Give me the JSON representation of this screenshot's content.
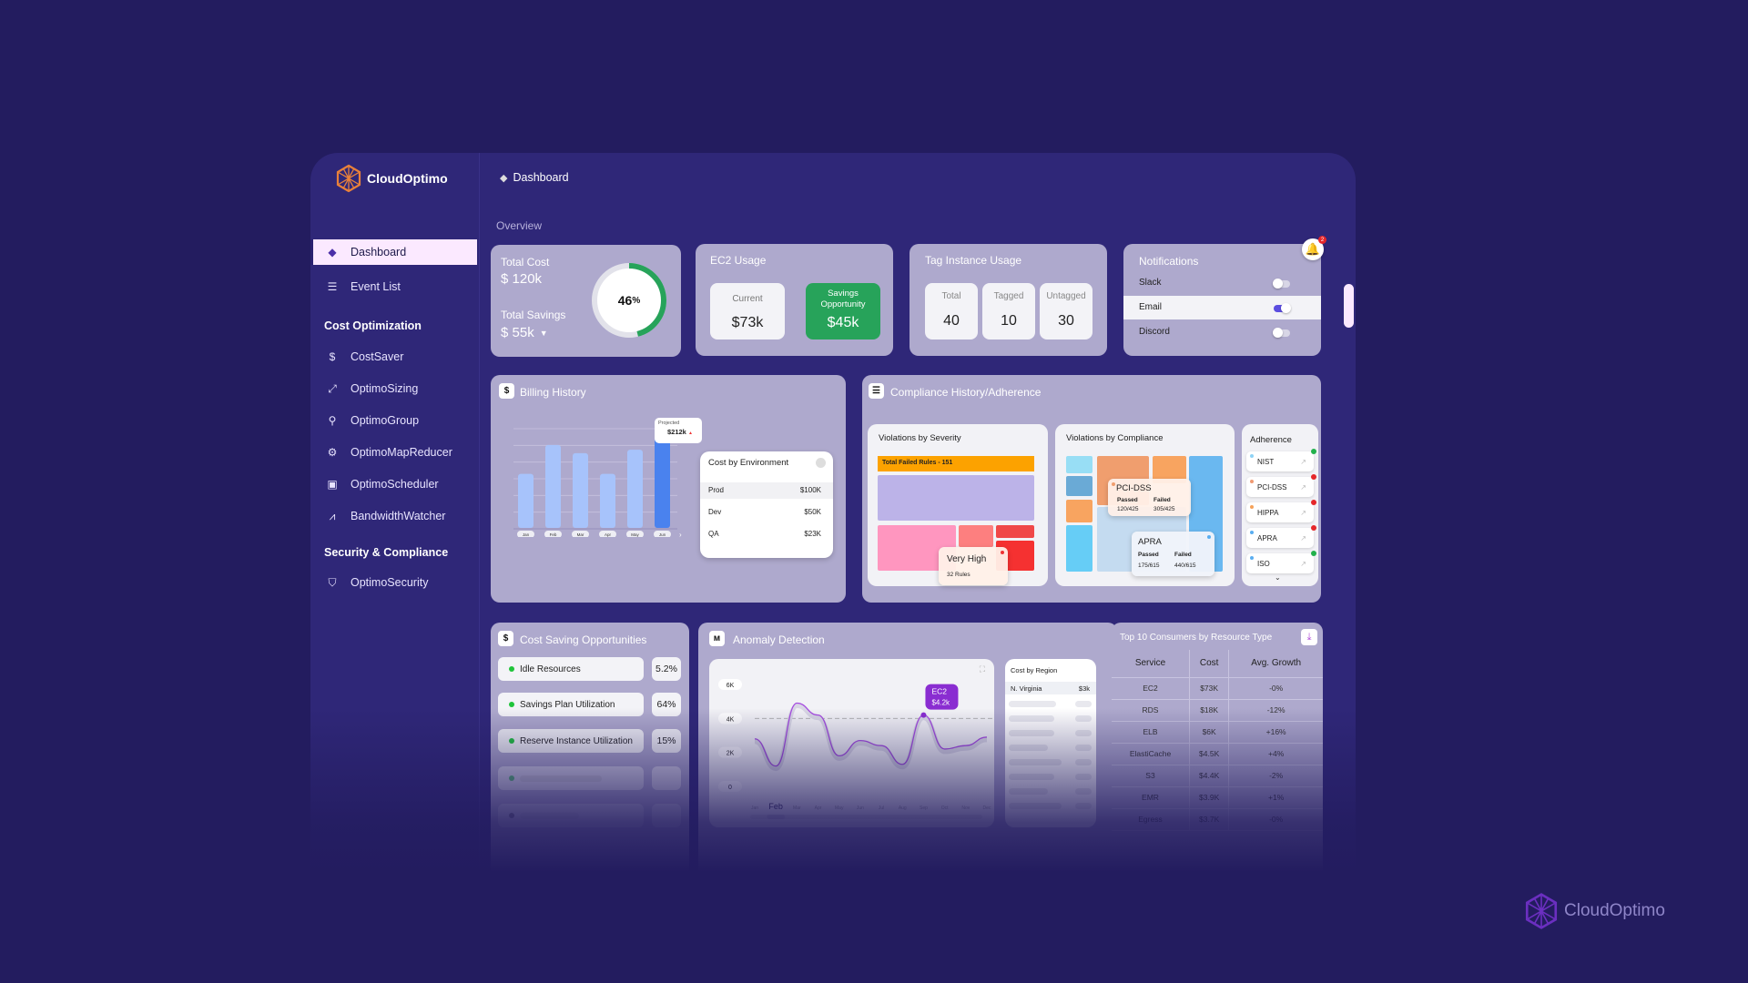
{
  "brand": {
    "name": "CloudOptimo",
    "accent": "#e9813a",
    "watermark": "CloudOptimo"
  },
  "sidebar": {
    "items": [
      {
        "label": "Dashboard",
        "icon": "layers-icon",
        "active": true
      },
      {
        "label": "Event List",
        "icon": "list-icon"
      }
    ],
    "sections": [
      {
        "title": "Cost Optimization",
        "items": [
          {
            "label": "CostSaver",
            "icon": "dollar-refresh-icon"
          },
          {
            "label": "OptimoSizing",
            "icon": "resize-icon"
          },
          {
            "label": "OptimoGroup",
            "icon": "group-icon"
          },
          {
            "label": "OptimoMapReducer",
            "icon": "gear-icon"
          },
          {
            "label": "OptimoScheduler",
            "icon": "calendar-check-icon"
          },
          {
            "label": "BandwidthWatcher",
            "icon": "line-chart-icon"
          }
        ]
      },
      {
        "title": "Security & Compliance",
        "items": [
          {
            "label": "OptimoSecurity",
            "icon": "shield-icon"
          }
        ]
      }
    ]
  },
  "header": {
    "breadcrumb": "Dashboard",
    "section_label": "Overview"
  },
  "total_cost": {
    "cost_label": "Total Cost",
    "cost_value": "$ 120k",
    "savings_label": "Total Savings",
    "savings_value": "$ 55k",
    "percent_text": "46",
    "percent_unit": "%",
    "percent": 46
  },
  "ec2_usage": {
    "title": "EC2 Usage",
    "current_label": "Current",
    "current_value": "$73k",
    "savings_label": "Savings Opportunity",
    "savings_value": "$45k"
  },
  "tag_usage": {
    "title": "Tag Instance Usage",
    "boxes": [
      {
        "label": "Total",
        "value": "40"
      },
      {
        "label": "Tagged",
        "value": "10"
      },
      {
        "label": "Untagged",
        "value": "30"
      }
    ]
  },
  "notifications": {
    "title": "Notifications",
    "badge_count": "2",
    "channels": [
      {
        "label": "Slack",
        "enabled": false
      },
      {
        "label": "Email",
        "enabled": true
      },
      {
        "label": "Discord",
        "enabled": false
      }
    ]
  },
  "billing_history": {
    "title": "Billing History",
    "projected_label": "Projected",
    "projected_value": "$212k",
    "cost_by_env": {
      "title": "Cost by Environment",
      "rows": [
        {
          "env": "Prod",
          "value": "$100K"
        },
        {
          "env": "Dev",
          "value": "$50K"
        },
        {
          "env": "QA",
          "value": "$23K"
        }
      ]
    }
  },
  "compliance": {
    "title": "Compliance History/Adherence",
    "severity": {
      "title": "Violations by Severity",
      "total_label": "Total Failed Rules - 151",
      "tooltip_title": "Very High",
      "tooltip_sub": "32 Rules"
    },
    "by_compliance": {
      "title": "Violations by Compliance",
      "tooltips": [
        {
          "name": "PCI-DSS",
          "passed_label": "Passed",
          "failed_label": "Failed",
          "passed": "120/425",
          "failed": "305/425"
        },
        {
          "name": "APRA",
          "passed_label": "Passed",
          "failed_label": "Failed",
          "passed": "175/615",
          "failed": "440/615"
        }
      ]
    },
    "adherence": {
      "title": "Adherence",
      "items": [
        {
          "label": "NIST",
          "status": "pass",
          "dot": "#8fd3f5"
        },
        {
          "label": "PCI-DSS",
          "status": "fail",
          "dot": "#f09a72"
        },
        {
          "label": "HIPPA",
          "status": "fail",
          "dot": "#f5a25a"
        },
        {
          "label": "APRA",
          "status": "fail",
          "dot": "#5aaef0"
        },
        {
          "label": "ISO",
          "status": "pass",
          "dot": "#5aaef0"
        }
      ]
    }
  },
  "cost_saving": {
    "title": "Cost Saving Opportunities",
    "items": [
      {
        "label": "Idle Resources",
        "value": "5.2%"
      },
      {
        "label": "Savings Plan Utilization",
        "value": "64%"
      },
      {
        "label": "Reserve Instance Utilization",
        "value": "15%"
      }
    ]
  },
  "anomaly": {
    "title": "Anomaly Detection",
    "tooltip_label": "EC2",
    "tooltip_value": "$4.2k",
    "cost_by_region": {
      "title": "Cost by Region",
      "rows": [
        {
          "region": "N. Virginia",
          "value": "$3k"
        }
      ]
    }
  },
  "top10": {
    "title": "Top 10 Consumers by Resource Type",
    "columns": [
      "Service",
      "Cost",
      "Avg. Growth"
    ],
    "rows": [
      [
        "EC2",
        "$73K",
        "-0%"
      ],
      [
        "RDS",
        "$18K",
        "-12%"
      ],
      [
        "ELB",
        "$6K",
        "+16%"
      ],
      [
        "ElastiCache",
        "$4.5K",
        "+4%"
      ],
      [
        "S3",
        "$4.4K",
        "-2%"
      ],
      [
        "EMR",
        "$3.9K",
        "+1%"
      ],
      [
        "Egress",
        "$3.7K",
        "-0%"
      ]
    ]
  },
  "chart_data": [
    {
      "type": "bar",
      "title": "Billing History",
      "categories": [
        "Jan",
        "Feb",
        "Mar",
        "Apr",
        "May",
        "Jun"
      ],
      "values": [
        112,
        172,
        155,
        112,
        162,
        200
      ],
      "highlight": "Jun",
      "annotation": "Projected $212k",
      "grid": true,
      "ylim": [
        0,
        200
      ]
    },
    {
      "type": "line",
      "title": "Anomaly Detection",
      "categories": [
        "Jan",
        "Feb",
        "Mar",
        "Apr",
        "May",
        "Jun",
        "Jul",
        "Aug",
        "Sep",
        "Oct",
        "Nov",
        "Dec"
      ],
      "values": [
        2.8,
        1.2,
        4.9,
        4.2,
        1.8,
        2.7,
        2.4,
        1.3,
        4.2,
        2.2,
        2.4,
        2.9
      ],
      "selected": "Feb",
      "yticks": [
        "0",
        "2K",
        "4K",
        "6K"
      ],
      "threshold": 4,
      "ylim": [
        0,
        6000
      ],
      "annotation": "EC2 $4.2k"
    }
  ]
}
